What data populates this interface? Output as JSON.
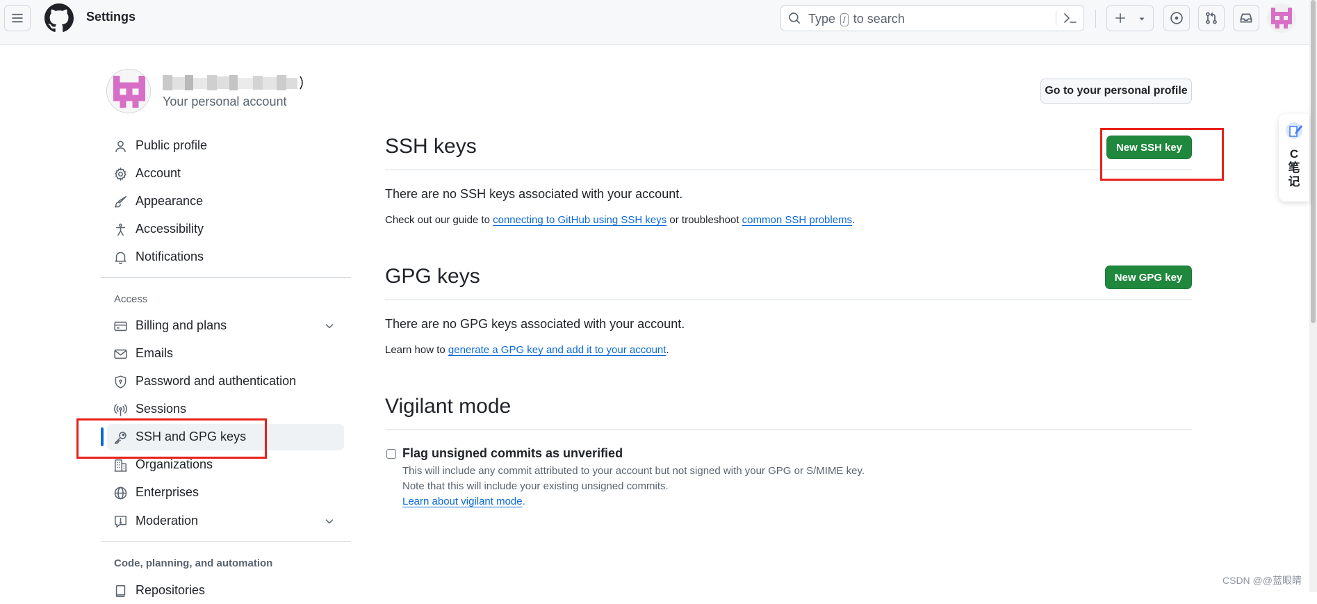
{
  "header": {
    "title": "Settings",
    "search": {
      "prefix": "Type",
      "key": "/",
      "suffix": "to search"
    }
  },
  "account": {
    "subtitle": "Your personal account",
    "profile_button": "Go to your personal profile"
  },
  "sidebar": {
    "items": [
      {
        "label": "Public profile",
        "icon": "person-icon"
      },
      {
        "label": "Account",
        "icon": "gear-icon"
      },
      {
        "label": "Appearance",
        "icon": "paintbrush-icon"
      },
      {
        "label": "Accessibility",
        "icon": "accessibility-icon"
      },
      {
        "label": "Notifications",
        "icon": "bell-icon"
      }
    ],
    "access_heading": "Access",
    "access_items": [
      {
        "label": "Billing and plans",
        "icon": "credit-card-icon",
        "expandable": true
      },
      {
        "label": "Emails",
        "icon": "mail-icon"
      },
      {
        "label": "Password and authentication",
        "icon": "shield-icon"
      },
      {
        "label": "Sessions",
        "icon": "broadcast-icon"
      },
      {
        "label": "SSH and GPG keys",
        "icon": "key-icon",
        "active": true
      },
      {
        "label": "Organizations",
        "icon": "organization-icon"
      },
      {
        "label": "Enterprises",
        "icon": "globe-icon"
      },
      {
        "label": "Moderation",
        "icon": "report-icon",
        "expandable": true
      }
    ],
    "code_heading": "Code, planning, and automation",
    "code_items": [
      {
        "label": "Repositories",
        "icon": "repo-icon"
      }
    ]
  },
  "ssh": {
    "title": "SSH keys",
    "button": "New SSH key",
    "empty": "There are no SSH keys associated with your account.",
    "guide_prefix": "Check out our guide to",
    "guide_link": "connecting to GitHub using SSH keys",
    "guide_middle": "or troubleshoot",
    "guide_link2": "common SSH problems",
    "guide_suffix": "."
  },
  "gpg": {
    "title": "GPG keys",
    "button": "New GPG key",
    "empty": "There are no GPG keys associated with your account.",
    "learn_prefix": "Learn how to",
    "learn_link": "generate a GPG key and add it to your account",
    "learn_suffix": "."
  },
  "vigilant": {
    "title": "Vigilant mode",
    "checkbox_label": "Flag unsigned commits as unverified",
    "checked": false,
    "note1": "This will include any commit attributed to your account but not signed with your GPG or S/MIME key.",
    "note2": "Note that this will include your existing unsigned commits.",
    "learn_link": "Learn about vigilant mode",
    "learn_suffix": "."
  },
  "widget": {
    "line1": "C",
    "line2": "笔",
    "line3": "记"
  },
  "watermark": "CSDN @@蓝眼睛",
  "colors": {
    "accent": "#0969da",
    "primary_button": "#1f883d",
    "annotation_red": "#e8201a",
    "avatar_pink": "#d86fc6"
  }
}
